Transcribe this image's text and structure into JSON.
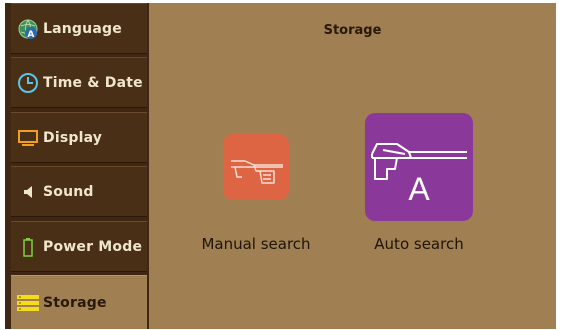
{
  "sidebar": {
    "items": [
      {
        "label": "Language",
        "icon": "globe-a-icon",
        "active": false
      },
      {
        "label": "Time & Date",
        "icon": "clock-icon",
        "active": false
      },
      {
        "label": "Display",
        "icon": "monitor-icon",
        "active": false
      },
      {
        "label": "Sound",
        "icon": "speaker-icon",
        "active": false
      },
      {
        "label": "Power Mode",
        "icon": "battery-icon",
        "active": false
      },
      {
        "label": "Storage",
        "icon": "storage-icon",
        "active": true
      }
    ]
  },
  "main": {
    "title": "Storage",
    "options": [
      {
        "label": "Manual search",
        "icon": "detector-icon",
        "color": "#dd6544"
      },
      {
        "label": "Auto search",
        "icon": "detector-auto-icon",
        "badge": "A",
        "color": "#8a399a"
      }
    ]
  },
  "colors": {
    "background": "#a08052",
    "sidebar": "#3f2713",
    "sidebar_item": "#4a2f17",
    "text_light": "#efe6cc"
  }
}
